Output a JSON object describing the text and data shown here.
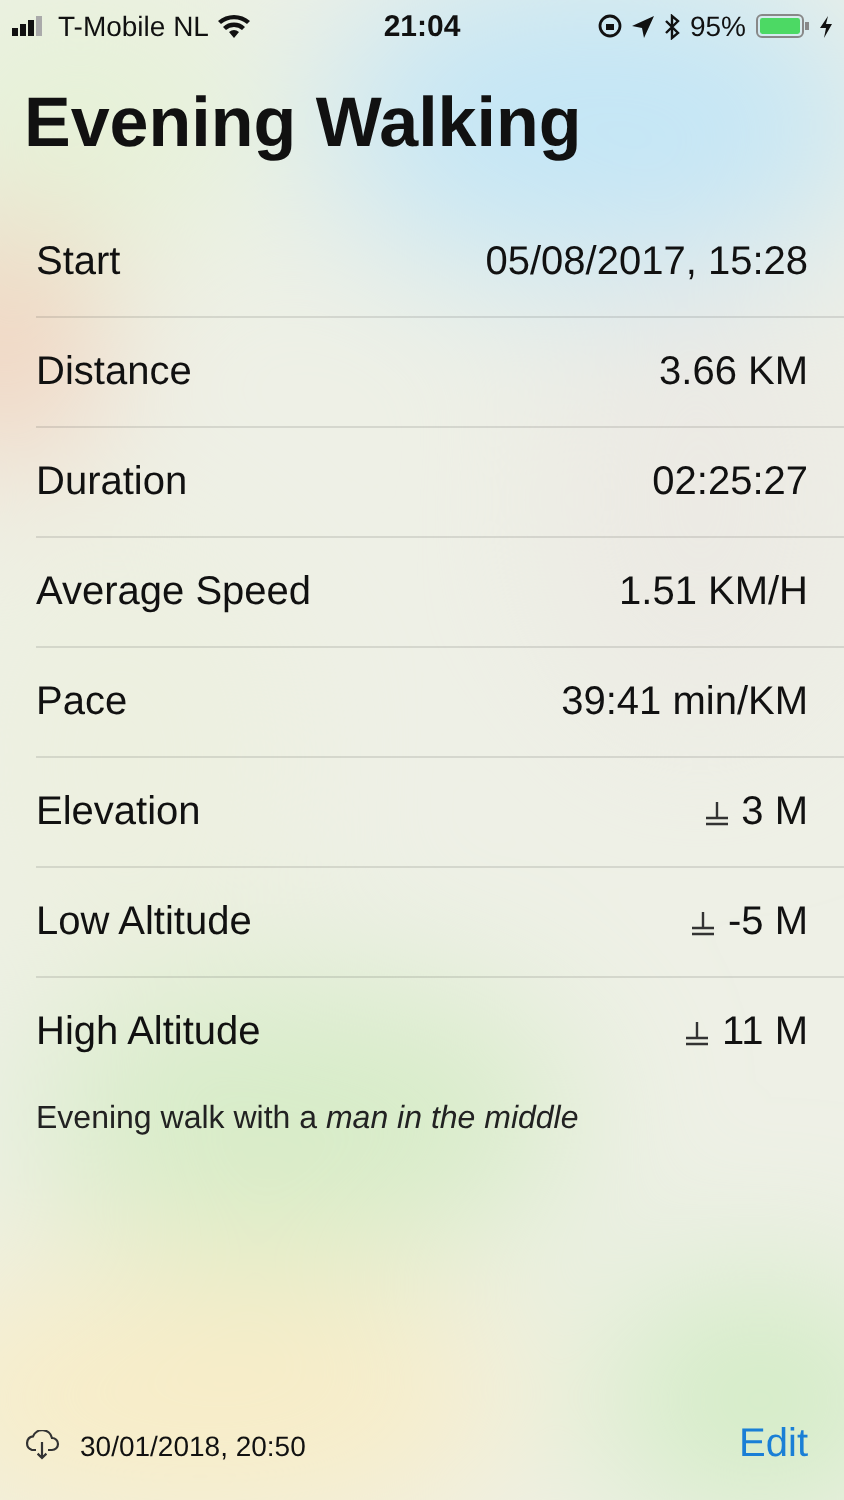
{
  "status_bar": {
    "carrier": "T-Mobile NL",
    "time": "21:04",
    "battery": "95%"
  },
  "title": "Evening Walking",
  "rows": [
    {
      "kind": "plain",
      "label": "Start",
      "value": "05/08/2017, 15:28"
    },
    {
      "kind": "plain",
      "label": "Distance",
      "value": "3.66 KM"
    },
    {
      "kind": "plain",
      "label": "Duration",
      "value": "02:25:27"
    },
    {
      "kind": "plain",
      "label": "Average Speed",
      "value": "1.51 KM/H"
    },
    {
      "kind": "plain",
      "label": "Pace",
      "value": "39:41 min/KM"
    },
    {
      "kind": "altitude",
      "label": "Elevation",
      "value": "3 M"
    },
    {
      "kind": "altitude",
      "label": "Low Altitude",
      "value": "-5 M"
    },
    {
      "kind": "altitude",
      "label": "High Altitude",
      "value": "11 M"
    }
  ],
  "note": "Evening walk with a *man in the middle*",
  "footer": {
    "synced": "30/01/2018, 20:50",
    "edit": "Edit"
  }
}
